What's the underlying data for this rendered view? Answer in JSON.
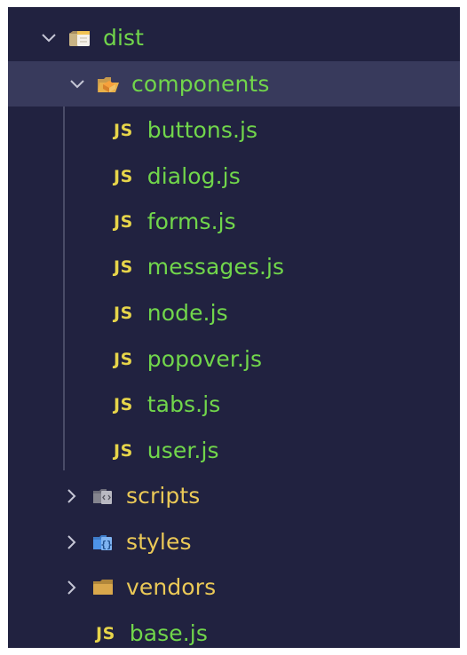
{
  "explorer": {
    "root": {
      "name": "dist",
      "expanded": true,
      "icon": "open-folder-icon",
      "children": {
        "components": {
          "name": "components",
          "expanded": true,
          "selected": true,
          "icon": "components-folder-icon",
          "files": [
            {
              "icon_label": "JS",
              "name": "buttons.js"
            },
            {
              "icon_label": "JS",
              "name": "dialog.js"
            },
            {
              "icon_label": "JS",
              "name": "forms.js"
            },
            {
              "icon_label": "JS",
              "name": "messages.js"
            },
            {
              "icon_label": "JS",
              "name": "node.js"
            },
            {
              "icon_label": "JS",
              "name": "popover.js"
            },
            {
              "icon_label": "JS",
              "name": "tabs.js"
            },
            {
              "icon_label": "JS",
              "name": "user.js"
            }
          ]
        },
        "folders": [
          {
            "name": "scripts",
            "expanded": false,
            "icon": "scripts-folder-icon"
          },
          {
            "name": "styles",
            "expanded": false,
            "icon": "styles-folder-icon"
          },
          {
            "name": "vendors",
            "expanded": false,
            "icon": "folder-icon"
          }
        ],
        "files": [
          {
            "icon_label": "JS",
            "name": "base.js"
          }
        ]
      }
    }
  },
  "colors": {
    "background": "#212240",
    "selection": "#383a5c",
    "modified_text": "#71d64b",
    "folder_text": "#ebc957",
    "js_icon": "#e7d54a",
    "chevron": "#c6c7d6"
  }
}
